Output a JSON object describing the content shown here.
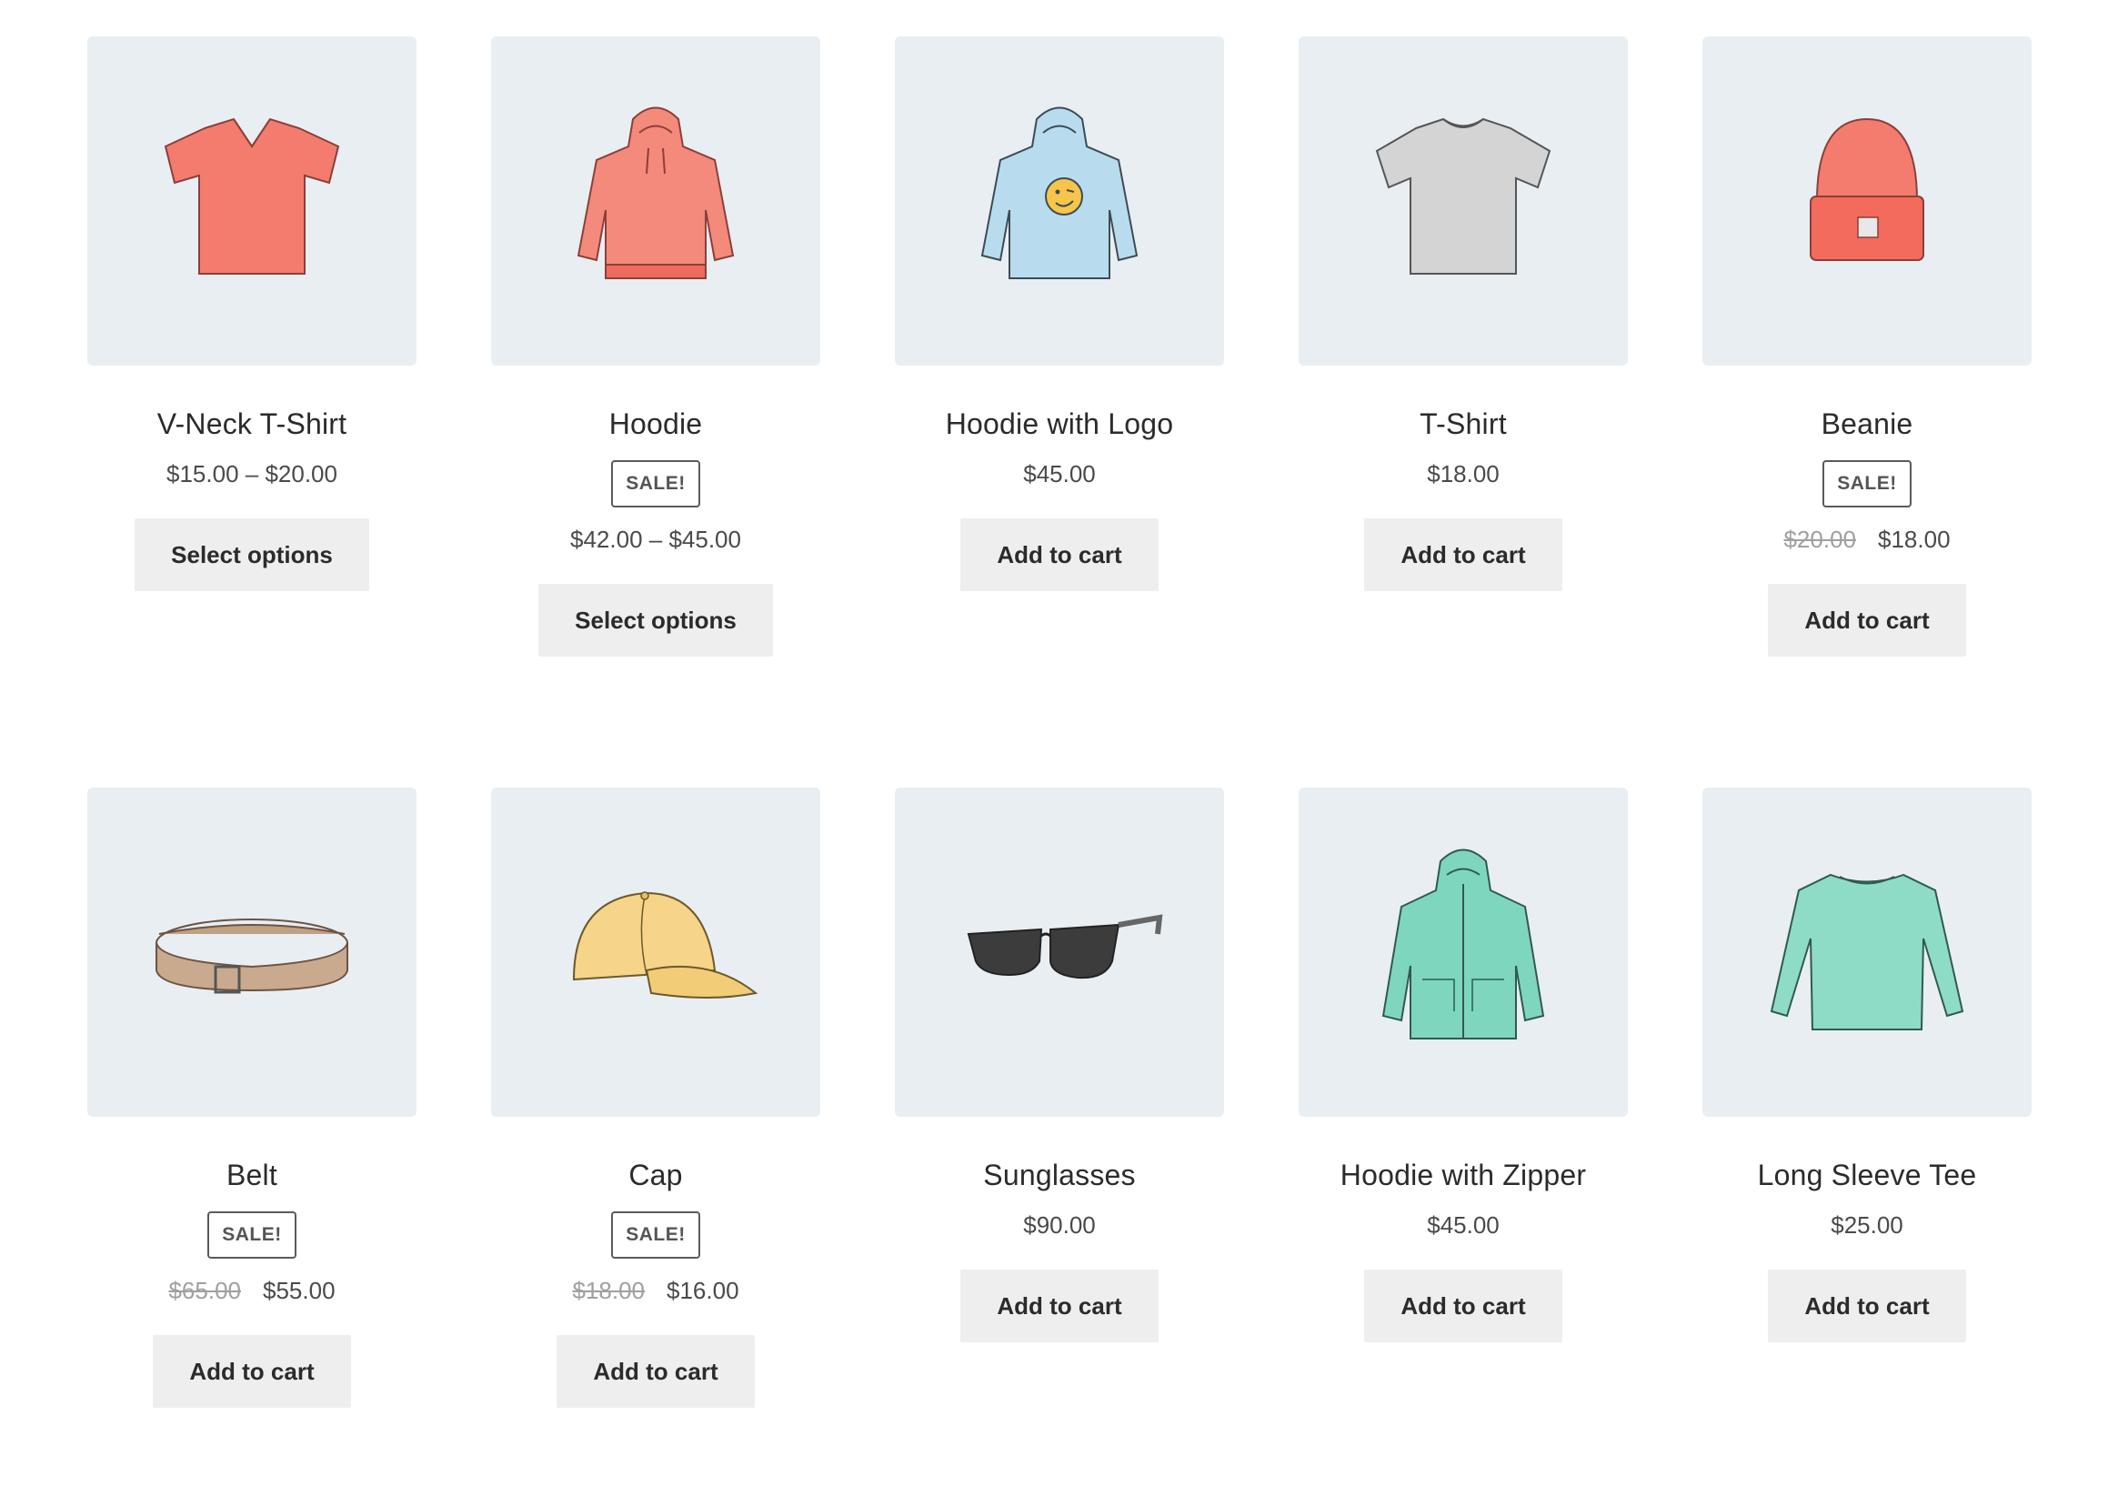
{
  "products": [
    {
      "title": "V-Neck T-Shirt",
      "price": "$15.00 – $20.00",
      "button": "Select options",
      "image_icon": "vneck-tshirt-icon",
      "color": "#f47c6f"
    },
    {
      "title": "Hoodie",
      "badge": "SALE!",
      "price": "$42.00 – $45.00",
      "button": "Select options",
      "image_icon": "hoodie-icon",
      "color": "#f48a7c"
    },
    {
      "title": "Hoodie with Logo",
      "price": "$45.00",
      "button": "Add to cart",
      "image_icon": "hoodie-logo-icon",
      "color": "#a9d4ea"
    },
    {
      "title": "T-Shirt",
      "price": "$18.00",
      "button": "Add to cart",
      "image_icon": "tshirt-icon",
      "color": "#cccccc"
    },
    {
      "title": "Beanie",
      "badge": "SALE!",
      "old_price": "$20.00",
      "price": "$18.00",
      "button": "Add to cart",
      "image_icon": "beanie-icon",
      "color": "#f47c6f"
    },
    {
      "title": "Belt",
      "badge": "SALE!",
      "old_price": "$65.00",
      "price": "$55.00",
      "button": "Add to cart",
      "image_icon": "belt-icon",
      "color": "#c9aa8e"
    },
    {
      "title": "Cap",
      "badge": "SALE!",
      "old_price": "$18.00",
      "price": "$16.00",
      "button": "Add to cart",
      "image_icon": "cap-icon",
      "color": "#f6d489"
    },
    {
      "title": "Sunglasses",
      "price": "$90.00",
      "button": "Add to cart",
      "image_icon": "sunglasses-icon",
      "color": "#4a4a4a"
    },
    {
      "title": "Hoodie with Zipper",
      "price": "$45.00",
      "button": "Add to cart",
      "image_icon": "hoodie-zipper-icon",
      "color": "#7fd6bf"
    },
    {
      "title": "Long Sleeve Tee",
      "price": "$25.00",
      "button": "Add to cart",
      "image_icon": "long-sleeve-tee-icon",
      "color": "#8fdcc6"
    }
  ]
}
